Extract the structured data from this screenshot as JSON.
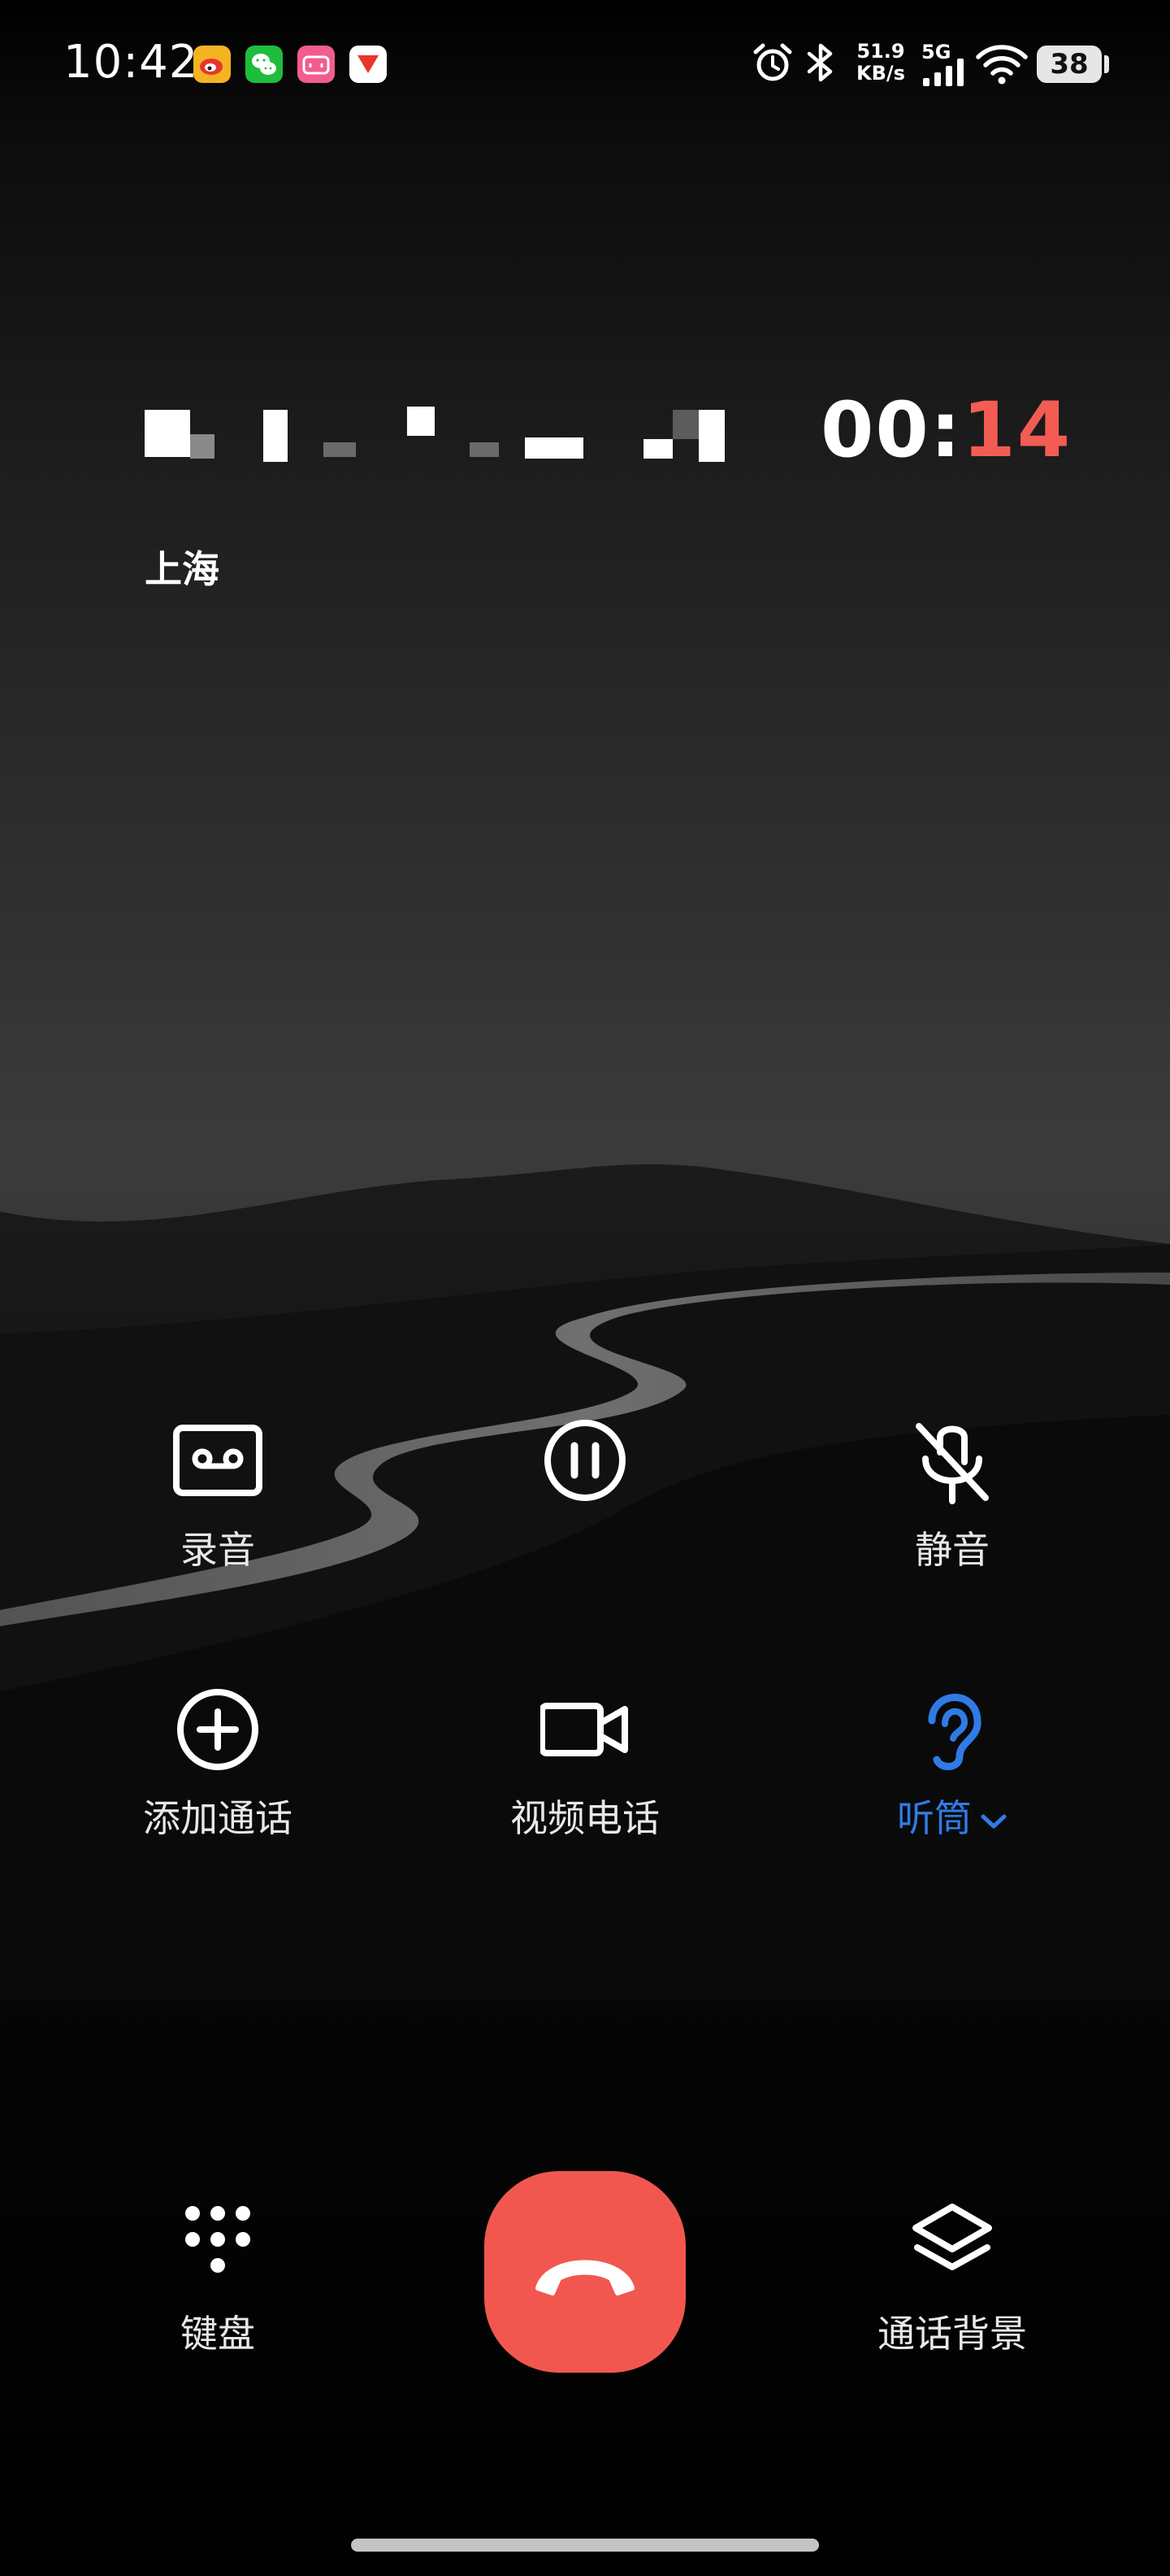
{
  "status_bar": {
    "time": "10:42",
    "notification_icons": [
      {
        "icon": "weibo-icon",
        "color": "#f5b324"
      },
      {
        "icon": "wechat-icon",
        "color": "#1fbd3c"
      },
      {
        "icon": "bilibili-icon",
        "color": "#f25d8e"
      },
      {
        "icon": "news-app-icon",
        "color": "#ffffff"
      }
    ],
    "net_speed_value": "51.9",
    "net_speed_unit": "KB/s",
    "network_type": "5G",
    "battery_level": "38"
  },
  "call": {
    "location": "上海",
    "timer_minutes": "00:",
    "timer_seconds": "14",
    "timer_seconds_color": "#f25c52"
  },
  "controls": {
    "row1": [
      {
        "label": "录音",
        "icon": "cassette-record-icon"
      },
      {
        "label": "",
        "icon": "pause-circle-icon"
      },
      {
        "label": "静音",
        "icon": "mic-off-icon"
      }
    ],
    "row2": [
      {
        "label": "添加通话",
        "icon": "add-circle-icon"
      },
      {
        "label": "视频电话",
        "icon": "video-camera-icon"
      },
      {
        "label": "听筒",
        "icon": "ear-icon",
        "active": true,
        "active_color": "#2f7be6"
      }
    ],
    "row3": [
      {
        "label": "键盘",
        "icon": "dialpad-icon"
      },
      {
        "label": "通话背景",
        "icon": "layers-icon"
      }
    ]
  },
  "end_call": {
    "icon": "hang-up-icon",
    "color": "#f2574f"
  }
}
